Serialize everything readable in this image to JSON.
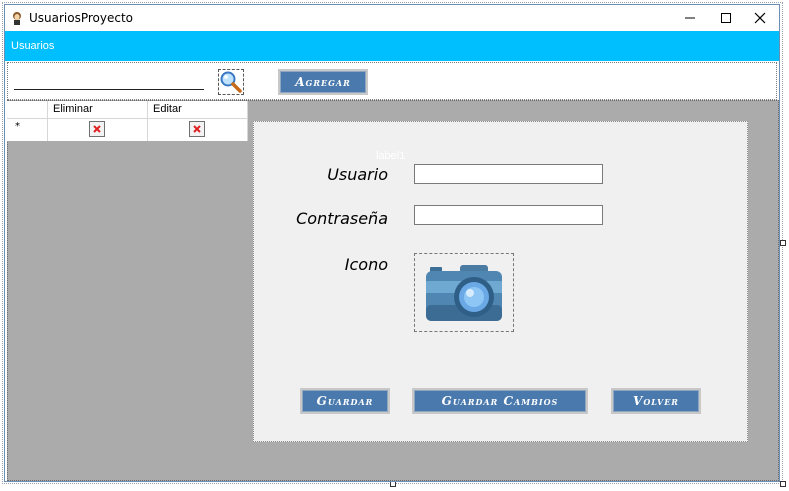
{
  "window": {
    "title": "UsuariosProyecto"
  },
  "header": {
    "title": "Usuarios"
  },
  "toolbar": {
    "search_value": "",
    "add_label": "Agregar"
  },
  "grid": {
    "columns": [
      "",
      "Eliminar",
      "Editar"
    ],
    "new_row_marker": "*"
  },
  "form": {
    "ghost_label": "label1",
    "user_label": "Usuario",
    "password_label": "Contraseña",
    "icon_label": "Icono",
    "user_value": "",
    "password_value": "",
    "save_label": "Guardar",
    "save_changes_label": "Guardar Cambios",
    "back_label": "Volver"
  },
  "colors": {
    "header_bar": "#00bfff",
    "button_fill": "#4a7aad",
    "body_background": "#ababab",
    "panel_background": "#f0f0f0"
  },
  "icons": [
    "app-icon",
    "minimize-icon",
    "maximize-icon",
    "close-icon",
    "search-icon",
    "delete-x-icon",
    "camera-icon"
  ]
}
